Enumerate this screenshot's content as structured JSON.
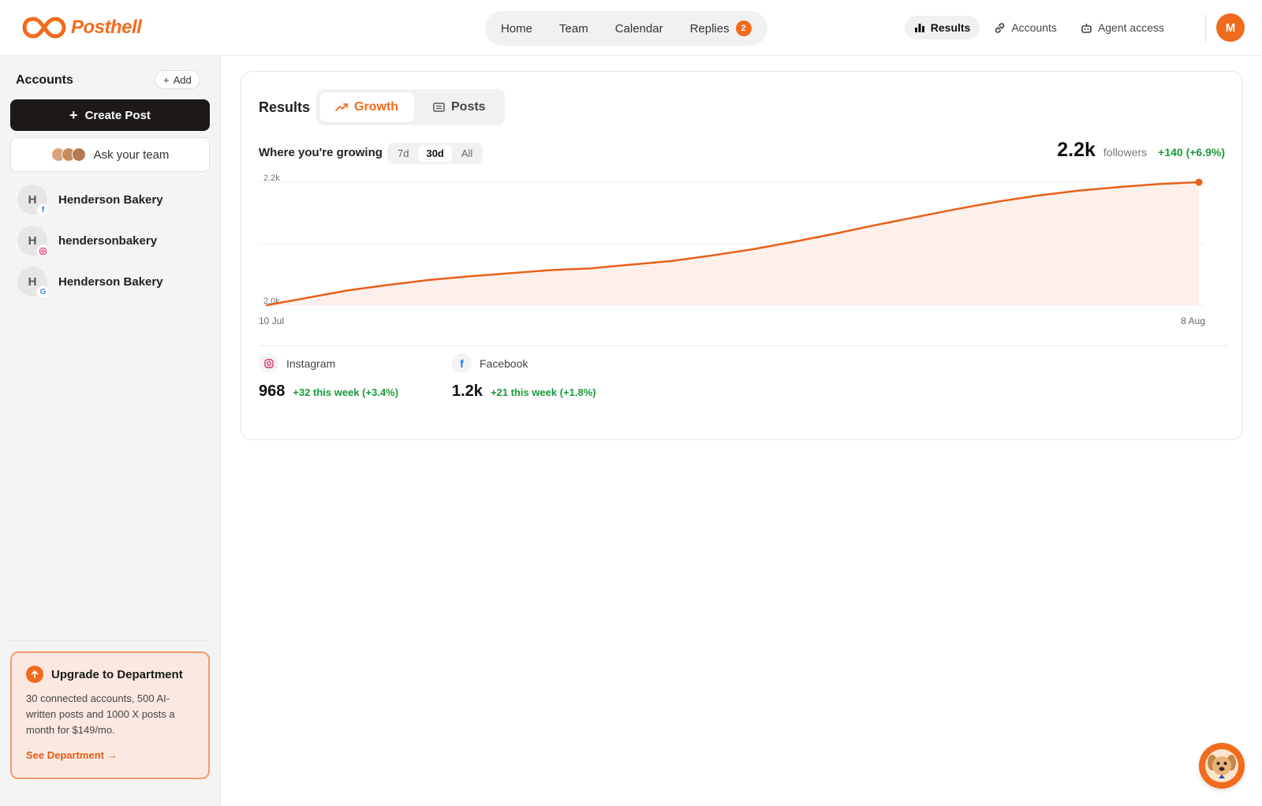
{
  "brand": {
    "name": "Posthell",
    "accent": "#f26b1d"
  },
  "nav": {
    "items": [
      {
        "label": "Home"
      },
      {
        "label": "Team"
      },
      {
        "label": "Calendar"
      },
      {
        "label": "Replies",
        "badge": "2"
      }
    ],
    "right": [
      {
        "label": "Results",
        "icon": "bar-chart-icon",
        "active": true
      },
      {
        "label": "Accounts",
        "icon": "link-icon"
      },
      {
        "label": "Agent access",
        "icon": "robot-icon"
      }
    ],
    "avatar_initial": "M"
  },
  "sidebar": {
    "heading": "Accounts",
    "add_label": "Add",
    "create_label": "Create Post",
    "ask_label": "Ask your team",
    "accounts": [
      {
        "initial": "H",
        "name": "Henderson Bakery",
        "platform": "facebook"
      },
      {
        "initial": "H",
        "name": "hendersonbakery",
        "platform": "instagram"
      },
      {
        "initial": "H",
        "name": "Henderson Bakery",
        "platform": "google"
      }
    ],
    "upgrade": {
      "title": "Upgrade to Department",
      "description": "30 connected accounts, 500 AI-written posts and 1000 X posts a month for $149/mo.",
      "link": "See Department →"
    }
  },
  "results": {
    "title": "Results",
    "tabs": [
      {
        "label": "Growth",
        "icon": "trending-up-icon",
        "active": true
      },
      {
        "label": "Posts",
        "icon": "list-icon",
        "active": false
      }
    ],
    "subtitle": "Where you're growing",
    "ranges": [
      {
        "label": "7d"
      },
      {
        "label": "30d",
        "active": true
      },
      {
        "label": "All"
      }
    ],
    "followers": {
      "value": "2.2k",
      "label": "followers",
      "change": "+140 (+6.9%)"
    },
    "platforms": [
      {
        "name": "Instagram",
        "value": "968",
        "change": "+32 this week (+3.4%)"
      },
      {
        "name": "Facebook",
        "value": "1.2k",
        "change": "+21 this week (+1.8%)"
      }
    ]
  },
  "chart_data": {
    "type": "area",
    "x_start_label": "10 Jul",
    "x_end_label": "8 Aug",
    "y_tick_labels": [
      "2.2k",
      "2.0k"
    ],
    "ylim": [
      2000,
      2200
    ],
    "values": [
      2000,
      2012,
      2024,
      2033,
      2041,
      2047,
      2052,
      2057,
      2060,
      2066,
      2072,
      2081,
      2091,
      2103,
      2116,
      2130,
      2143,
      2156,
      2168,
      2178,
      2186,
      2192,
      2197,
      2200
    ],
    "color": "#e8601a",
    "fill": "#fdf0ea",
    "grid": true
  }
}
